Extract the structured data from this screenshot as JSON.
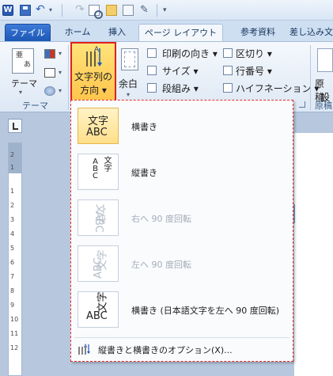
{
  "qat": {
    "app_letter": "W",
    "undo_arrow": "▾",
    "more_label": "▾"
  },
  "tabs": [
    "ファイル",
    "ホーム",
    "挿入",
    "ページ レイアウト",
    "参考資料",
    "差し込み文"
  ],
  "ribbon": {
    "theme": {
      "label": "テーマ",
      "icon_text": "亜",
      "icon_text2": "あ",
      "arrow": "▾",
      "group_label": "テーマ"
    },
    "text_direction": {
      "label_line1": "文字列の",
      "label_line2": "方向 ▾"
    },
    "margins": {
      "label": "余白",
      "arrow": "▾"
    },
    "page_setup": {
      "orientation": "印刷の向き ▾",
      "size": "サイズ ▾",
      "columns": "段組み ▾",
      "breaks": "区切り ▾",
      "line_numbers": "行番号 ▾",
      "hyphenation": "ハイフネーション ▾"
    },
    "right_button": {
      "label_line1": "原稿",
      "label_line2": "設",
      "group_label": "原稿"
    }
  },
  "ruler_numbers": [
    "2",
    "1",
    "1",
    "2",
    "3",
    "4",
    "5",
    "6",
    "7",
    "8",
    "9",
    "10",
    "11",
    "12"
  ],
  "menu": {
    "items": [
      {
        "label": "横書き",
        "thumb_line1": "文字",
        "thumb_line2": "ABC",
        "state": "selected"
      },
      {
        "label": "縦書き",
        "thumb_line1": "文字",
        "thumb_line2": "ABC",
        "state": "normal"
      },
      {
        "label": "右へ 90 度回転",
        "thumb_line1": "文字",
        "thumb_line2": "ABC",
        "state": "disabled"
      },
      {
        "label": "左へ 90 度回転",
        "thumb_line1": "文字",
        "thumb_line2": "ABC",
        "state": "disabled"
      },
      {
        "label": "横書き (日本語文字を左へ 90 度回転)",
        "thumb_line1": "文字",
        "thumb_line2": "ABC",
        "state": "normal"
      }
    ],
    "footer_label": "縦書きと横書きのオプション(X)..."
  },
  "colors": {
    "accent_red": "#e02121",
    "highlight": "#ffc54d",
    "tab_file": "#1c57b5"
  }
}
